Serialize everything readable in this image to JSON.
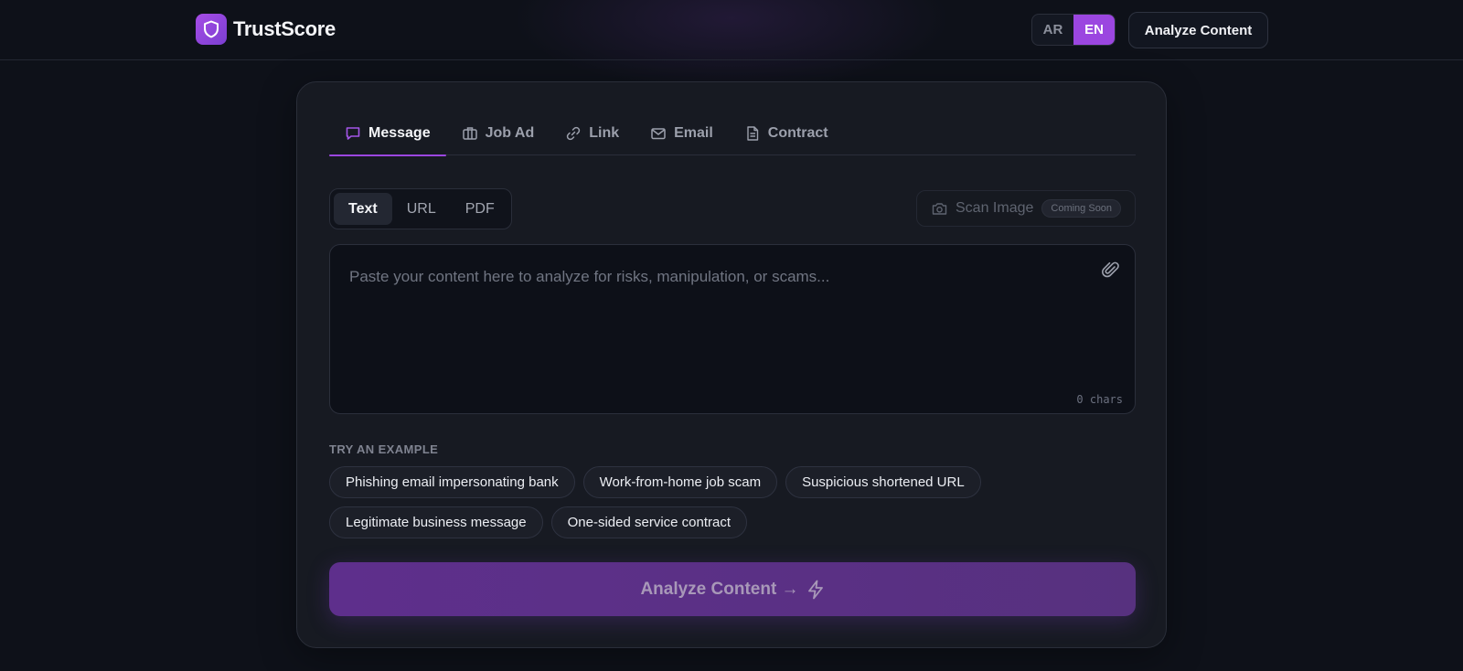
{
  "header": {
    "brand_name": "TrustScore",
    "logo_icon": "shield-icon",
    "lang_ar": "AR",
    "lang_en": "EN",
    "active_lang": "EN",
    "cta_label": "Analyze Content"
  },
  "tabs": [
    {
      "label": "Message",
      "icon": "message-icon",
      "active": true
    },
    {
      "label": "Job Ad",
      "icon": "briefcase-icon",
      "active": false
    },
    {
      "label": "Link",
      "icon": "link-icon",
      "active": false
    },
    {
      "label": "Email",
      "icon": "mail-icon",
      "active": false
    },
    {
      "label": "Contract",
      "icon": "document-icon",
      "active": false
    }
  ],
  "input_modes": [
    {
      "label": "Text",
      "active": true
    },
    {
      "label": "URL",
      "active": false
    },
    {
      "label": "PDF",
      "active": false
    }
  ],
  "scan": {
    "label": "Scan Image",
    "badge": "Coming Soon",
    "icon": "camera-icon"
  },
  "content_input": {
    "placeholder": "Paste your content here to analyze for risks, manipulation, or scams...",
    "value": "",
    "char_count": "0 chars",
    "attach_icon": "paperclip-icon"
  },
  "examples": {
    "title": "TRY AN EXAMPLE",
    "items": [
      "Phishing email impersonating bank",
      "Work-from-home job scam",
      "Suspicious shortened URL",
      "Legitimate business message",
      "One-sided service contract"
    ]
  },
  "analyze_button": {
    "label": "Analyze Content →",
    "icon": "lightning-icon"
  },
  "colors": {
    "accent": "#9b46e0",
    "background": "#0e1119",
    "card": "#171a22"
  }
}
